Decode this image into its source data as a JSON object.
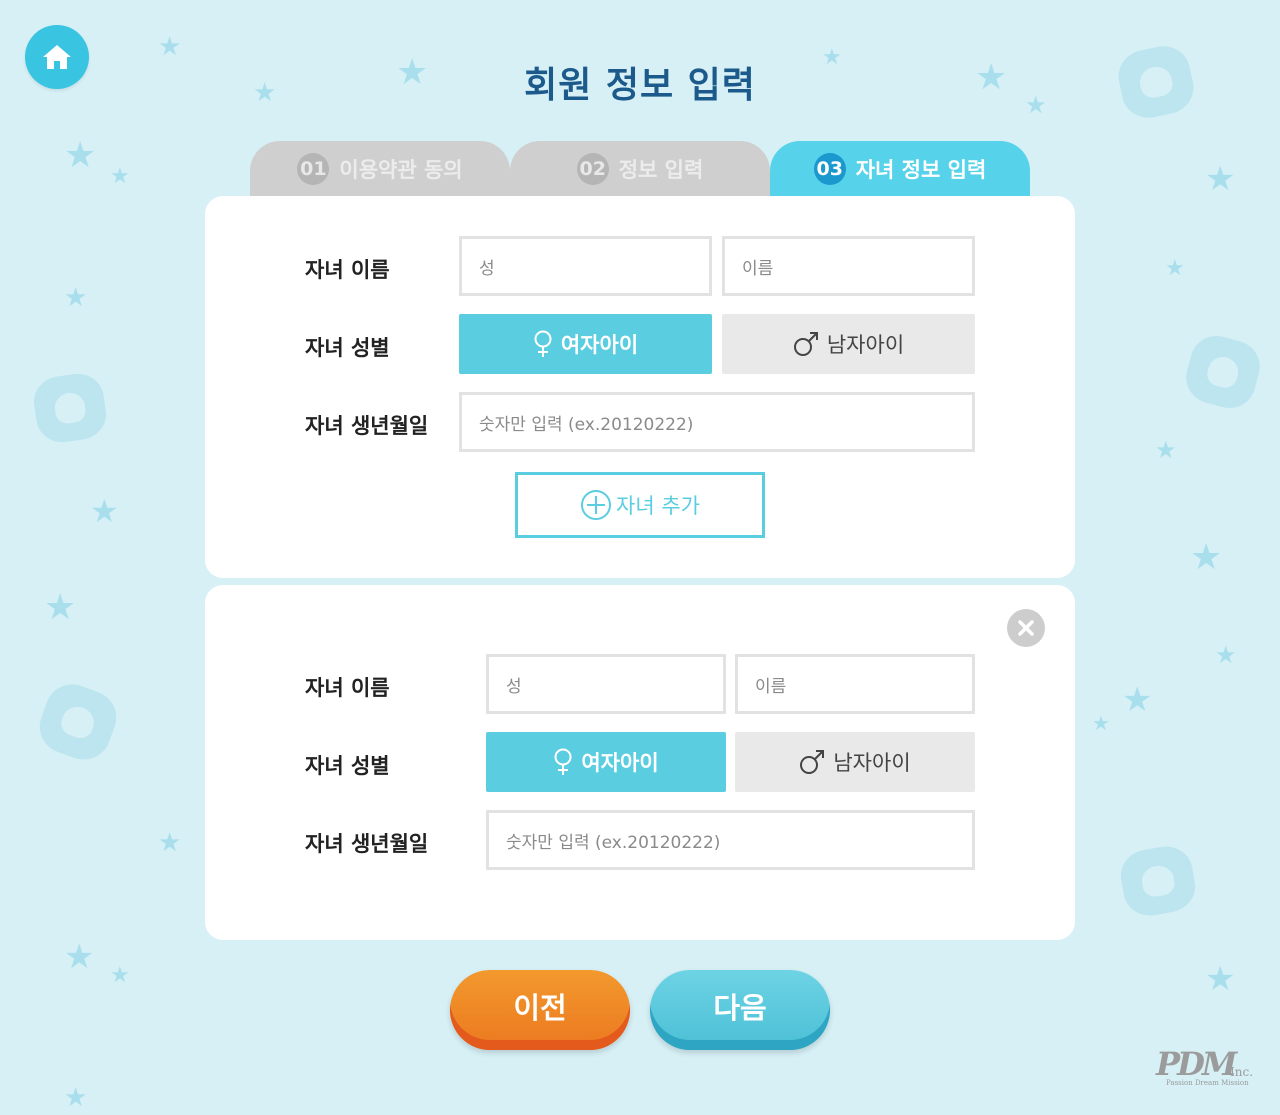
{
  "header": {
    "title": "회원 정보 입력"
  },
  "tabs": [
    {
      "num": "01",
      "label": "이용약관 동의",
      "active": false
    },
    {
      "num": "02",
      "label": "정보 입력",
      "active": false
    },
    {
      "num": "03",
      "label": "자녀 정보 입력",
      "active": true
    }
  ],
  "children": [
    {
      "name_label": "자녀 이름",
      "last_name_placeholder": "성",
      "first_name_placeholder": "이름",
      "gender_label": "자녀 성별",
      "female_label": "여자아이",
      "male_label": "남자아이",
      "selected_gender": "female",
      "birth_label": "자녀 생년월일",
      "birth_placeholder": "숫자만 입력 (ex.20120222)"
    },
    {
      "name_label": "자녀 이름",
      "last_name_placeholder": "성",
      "first_name_placeholder": "이름",
      "gender_label": "자녀 성별",
      "female_label": "여자아이",
      "male_label": "남자아이",
      "selected_gender": "female",
      "birth_label": "자녀 생년월일",
      "birth_placeholder": "숫자만 입력 (ex.20120222)"
    }
  ],
  "add_child_label": "자녀 추가",
  "footer": {
    "prev_label": "이전",
    "next_label": "다음"
  },
  "logo": {
    "main": "PDM",
    "suffix": "Inc.",
    "tagline": "Passion Dream Mission"
  },
  "colors": {
    "background": "#d6f0f6",
    "accent": "#5bcde0",
    "title": "#1c5a8c",
    "prev_button": "#ec7820",
    "next_button": "#4bbfd6"
  },
  "icons": {
    "home": "home-icon",
    "female": "female-icon",
    "male": "male-icon",
    "add": "plus-circle-icon",
    "close": "close-icon"
  }
}
